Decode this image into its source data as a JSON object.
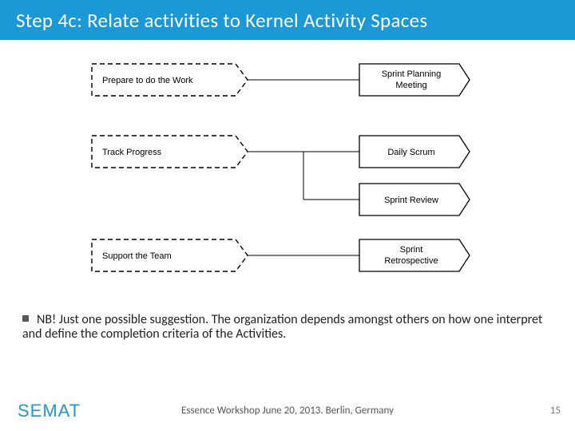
{
  "title": "Step 4c: Relate activities to Kernel Activity Spaces",
  "diagram": {
    "left_boxes": [
      {
        "label": "Prepare to do the Work"
      },
      {
        "label": "Track Progress"
      },
      {
        "label": "Support the Team"
      }
    ],
    "right_boxes": [
      {
        "line1": "Sprint Planning",
        "line2": "Meeting"
      },
      {
        "line1": "Daily Scrum",
        "line2": ""
      },
      {
        "line1": "Sprint Review",
        "line2": ""
      },
      {
        "line1": "Sprint",
        "line2": "Retrospective"
      }
    ]
  },
  "note": "NB! Just one possible suggestion. The organization depends amongst others on how one interpret and define the completion criteria of the Activities.",
  "footer": "Essence Workshop June 20, 2013. Berlin, Germany",
  "page_number": "15",
  "logo_text": "SEMAT"
}
